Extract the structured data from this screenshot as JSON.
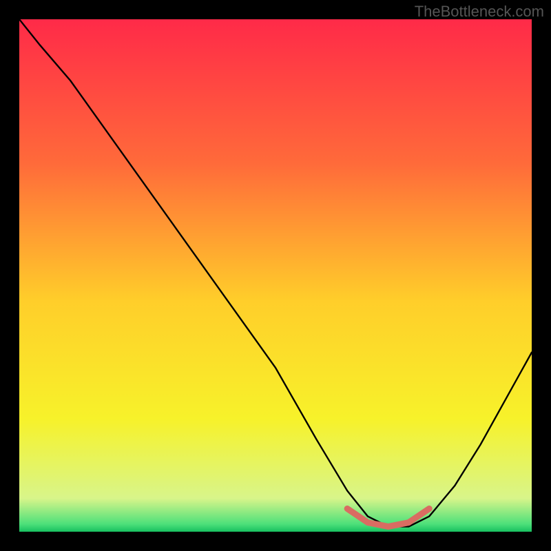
{
  "watermark": "TheBottleneck.com",
  "chart_data": {
    "type": "line",
    "title": "",
    "xlabel": "",
    "ylabel": "",
    "xlim": [
      0,
      100
    ],
    "ylim": [
      0,
      100
    ],
    "series": [
      {
        "name": "curve",
        "x": [
          0,
          4,
          10,
          20,
          30,
          40,
          50,
          58,
          64,
          68,
          72,
          76,
          80,
          85,
          90,
          95,
          100
        ],
        "values": [
          100,
          95,
          88,
          74,
          60,
          46,
          32,
          18,
          8,
          3,
          1,
          1,
          3,
          9,
          17,
          26,
          35
        ]
      }
    ],
    "highlight_segment": {
      "name": "bottleneck-zone",
      "x": [
        64,
        68,
        72,
        76,
        80
      ],
      "values": [
        4.5,
        1.8,
        1,
        1.8,
        4.5
      ],
      "color": "#d96c62"
    },
    "gradient_stops": [
      {
        "offset": 0.0,
        "color": "#ff2a48"
      },
      {
        "offset": 0.28,
        "color": "#ff6a3a"
      },
      {
        "offset": 0.55,
        "color": "#ffce2a"
      },
      {
        "offset": 0.78,
        "color": "#f7f22a"
      },
      {
        "offset": 0.935,
        "color": "#d8f58a"
      },
      {
        "offset": 0.985,
        "color": "#4de07a"
      },
      {
        "offset": 1.0,
        "color": "#18c060"
      }
    ]
  }
}
